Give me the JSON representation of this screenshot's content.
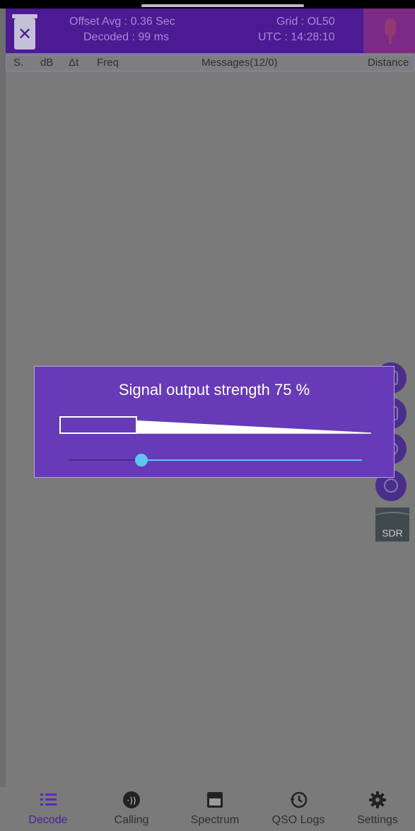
{
  "header": {
    "offset_avg": "Offset Avg : 0.36 Sec",
    "decoded": "Decoded : 99 ms",
    "grid": "Grid : OL50",
    "utc": "UTC : 14:28:10"
  },
  "columns": {
    "snr": "S.",
    "db": "dB",
    "dt": "Δt",
    "freq": "Freq",
    "messages": "Messages(12/0)",
    "distance": "Distance"
  },
  "side_buttons": {
    "sdr_label": "SDR"
  },
  "dialog": {
    "title": "Signal output strength 75 %",
    "level_fraction": 0.75
  },
  "nav": {
    "items": [
      {
        "label": "Decode",
        "icon": "list-icon"
      },
      {
        "label": "Calling",
        "icon": "calling-icon"
      },
      {
        "label": "Spectrum",
        "icon": "spectrum-icon"
      },
      {
        "label": "QSO Logs",
        "icon": "history-icon"
      },
      {
        "label": "Settings",
        "icon": "gear-icon"
      }
    ]
  },
  "colors": {
    "header_bg": "#4c1a93",
    "dialog_bg": "#673ab7",
    "slider": "#5ec5ee",
    "active_nav": "#4a1e9c"
  }
}
